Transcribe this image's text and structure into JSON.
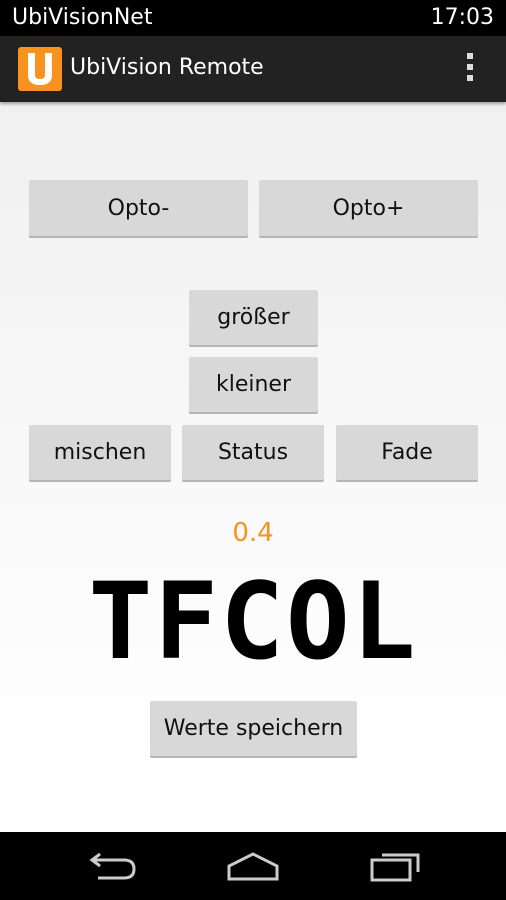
{
  "status_bar": {
    "carrier": "UbiVisionNet",
    "time": "17:03"
  },
  "action_bar": {
    "title": "UbiVision Remote",
    "icon": "app-logo-icon",
    "menu_icon": "overflow-menu-icon"
  },
  "buttons": {
    "opto_minus": "Opto-",
    "opto_plus": "Opto+",
    "groesser": "größer",
    "kleiner": "kleiner",
    "mischen": "mischen",
    "status": "Status",
    "fade": "Fade",
    "save": "Werte speichern"
  },
  "display": {
    "value": "0.4",
    "text": "TFCOL"
  },
  "nav_bar": {
    "back": "back-icon",
    "home": "home-icon",
    "recents": "recents-icon"
  },
  "colors": {
    "accent": "#f7931e",
    "action_bar": "#222222",
    "button": "#d8d8d8"
  }
}
